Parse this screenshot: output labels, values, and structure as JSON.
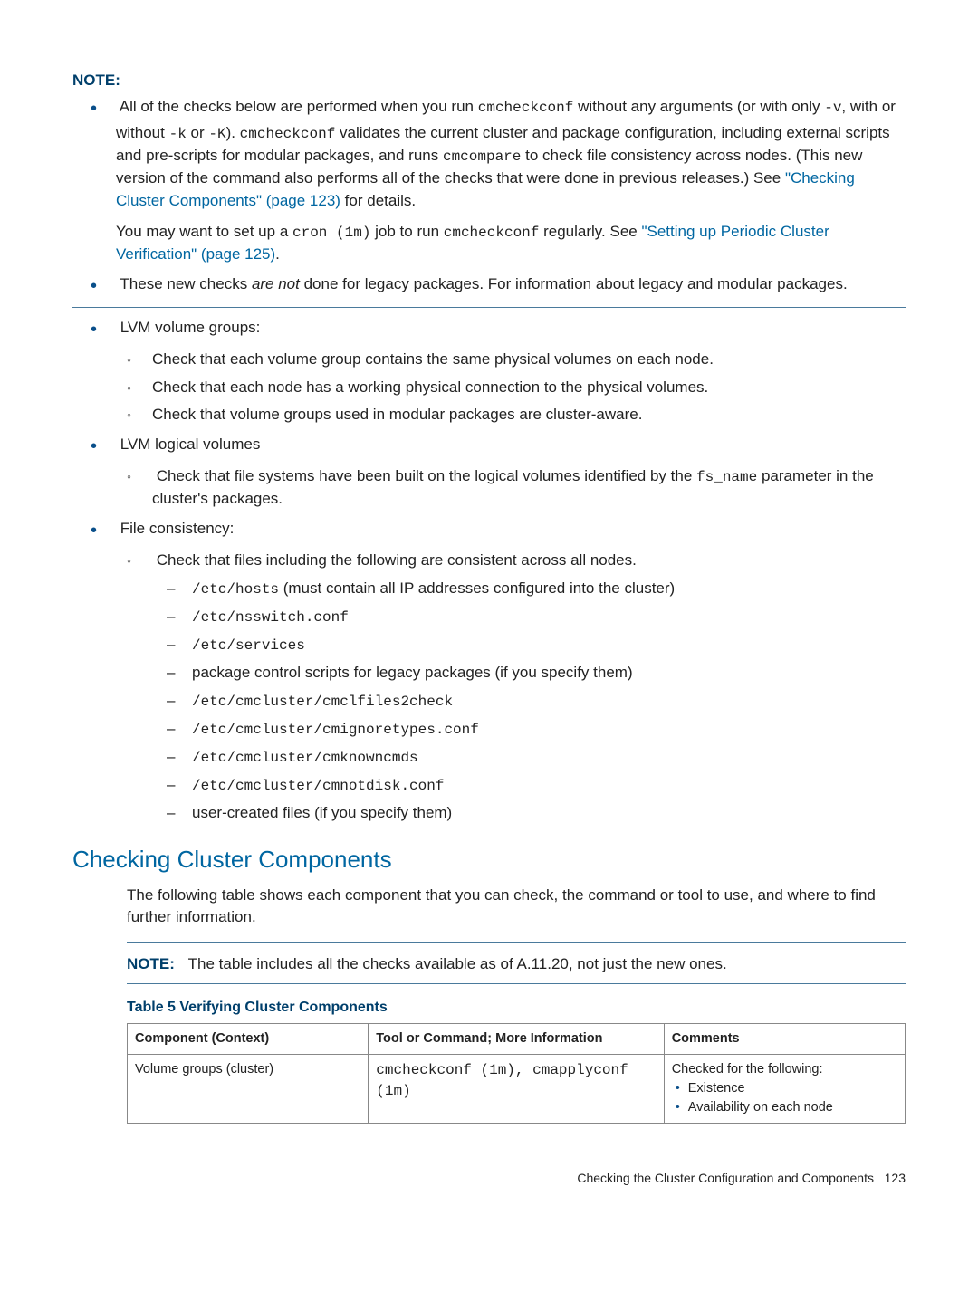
{
  "note1": {
    "label": "NOTE:",
    "b1a": "All of the checks below are performed when you run ",
    "b1_code1": "cmcheckconf",
    "b1b": " without any arguments (or with only ",
    "b1_code2": "-v",
    "b1c": ", with or without ",
    "b1_code3": "-k",
    "b1d": " or ",
    "b1_code4": "-K",
    "b1e": "). ",
    "b1_code5": "cmcheckconf",
    "b1f": " validates the current cluster and package configuration, including external scripts and pre-scripts for modular packages, and runs ",
    "b1_code6": "cmcompare",
    "b1g": " to check file consistency across nodes. (This new version of the command also performs all of the checks that were done in previous releases.) See ",
    "b1_link": "\"Checking Cluster Components\" (page 123)",
    "b1h": " for details.",
    "b1p2a": "You may want to set up a ",
    "b1p2_code1": "cron (1m)",
    "b1p2b": " job to run ",
    "b1p2_code2": "cmcheckconf",
    "b1p2c": " regularly. See ",
    "b1p2_link": "\"Setting up Periodic Cluster Verification\" (page 125)",
    "b1p2d": ".",
    "b2a": "These new checks ",
    "b2_em": "are not",
    "b2b": " done for legacy packages. For information about legacy and modular packages."
  },
  "mainlist": {
    "lvm_vg": "LVM volume groups:",
    "lvm_vg_sub1": "Check that each volume group contains the same physical volumes on each node.",
    "lvm_vg_sub2": "Check that each node has a working physical connection to the physical volumes.",
    "lvm_vg_sub3": "Check that volume groups used in modular packages are cluster-aware.",
    "lvm_lv": "LVM logical volumes",
    "lvm_lv_sub1a": "Check that file systems have been built on the logical volumes identified by the ",
    "lvm_lv_sub1_code": "fs_name",
    "lvm_lv_sub1b": " parameter in the cluster's packages.",
    "fc": "File consistency:",
    "fc_sub1": "Check that files including the following are consistent across all nodes.",
    "fc_d1_code": "/etc/hosts",
    "fc_d1_text": " (must contain all IP addresses configured into the cluster)",
    "fc_d2": "/etc/nsswitch.conf",
    "fc_d3": "/etc/services",
    "fc_d4": "package control scripts for legacy packages (if you specify them)",
    "fc_d5": "/etc/cmcluster/cmclfiles2check",
    "fc_d6": "/etc/cmcluster/cmignoretypes.conf",
    "fc_d7": "/etc/cmcluster/cmknowncmds",
    "fc_d8": "/etc/cmcluster/cmnotdisk.conf",
    "fc_d9": "user-created files (if you specify them)"
  },
  "section": {
    "heading": "Checking Cluster Components",
    "intro": "The following table shows each component that you can check, the command or tool to use, and where to find further information."
  },
  "note2": {
    "label": "NOTE:",
    "text": "The table includes all the checks available as of A.11.20, not just the new ones."
  },
  "table": {
    "caption": "Table 5 Verifying Cluster Components",
    "h1": "Component (Context)",
    "h2": "Tool or Command; More Information",
    "h3": "Comments",
    "r1c1": "Volume groups (cluster)",
    "r1c2": "cmcheckconf (1m), cmapplyconf (1m)",
    "r1c3_intro": "Checked for the following:",
    "r1c3_b1": "Existence",
    "r1c3_b2": "Availability on each node"
  },
  "footer": {
    "text": "Checking the Cluster Configuration and Components",
    "page": "123"
  }
}
